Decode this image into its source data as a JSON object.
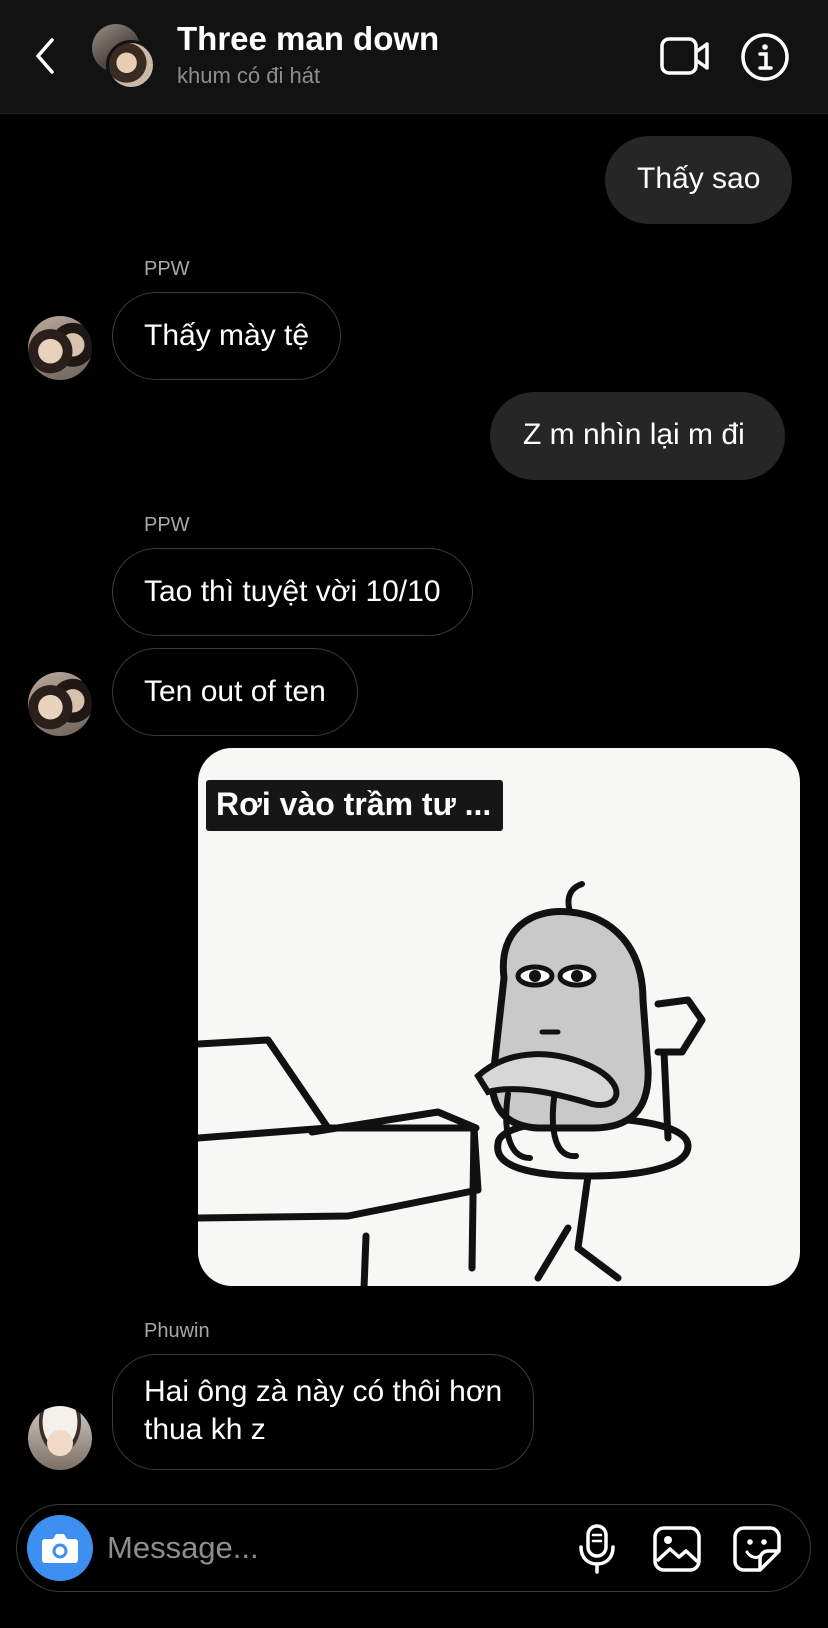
{
  "header": {
    "title": "Three man down",
    "subtitle": "khum có đi hát"
  },
  "messages": [
    {
      "direction": "outgoing",
      "text": "Thấy sao"
    },
    {
      "direction": "incoming",
      "sender": "PPW",
      "text": "Thấy mày tệ"
    },
    {
      "direction": "outgoing",
      "text": "Z m nhìn lại m đi"
    },
    {
      "direction": "incoming",
      "sender": "PPW",
      "text": "Tao thì tuyệt vời 10/10"
    },
    {
      "direction": "incoming",
      "text": "Ten out of ten"
    },
    {
      "direction": "outgoing",
      "type": "sticker",
      "caption": "Rơi vào trầm tư ..."
    },
    {
      "direction": "incoming",
      "sender": "Phuwin",
      "text_line1": "Hai ông zà này có thôi hơn",
      "text_line2": "thua kh z"
    }
  ],
  "composer": {
    "placeholder": "Message..."
  },
  "icons": {
    "back": "chevron-left-icon",
    "video": "video-camera-icon",
    "info": "info-icon",
    "camera": "camera-icon",
    "mic": "microphone-icon",
    "gallery": "image-gallery-icon",
    "sticker": "sticker-icon"
  },
  "colors": {
    "background": "#000000",
    "header": "#121212",
    "outgoing_bubble": "#262626",
    "incoming_border": "#3a3a3a",
    "camera_button": "#3d8ff0",
    "secondary_text": "#8e8e8e"
  }
}
